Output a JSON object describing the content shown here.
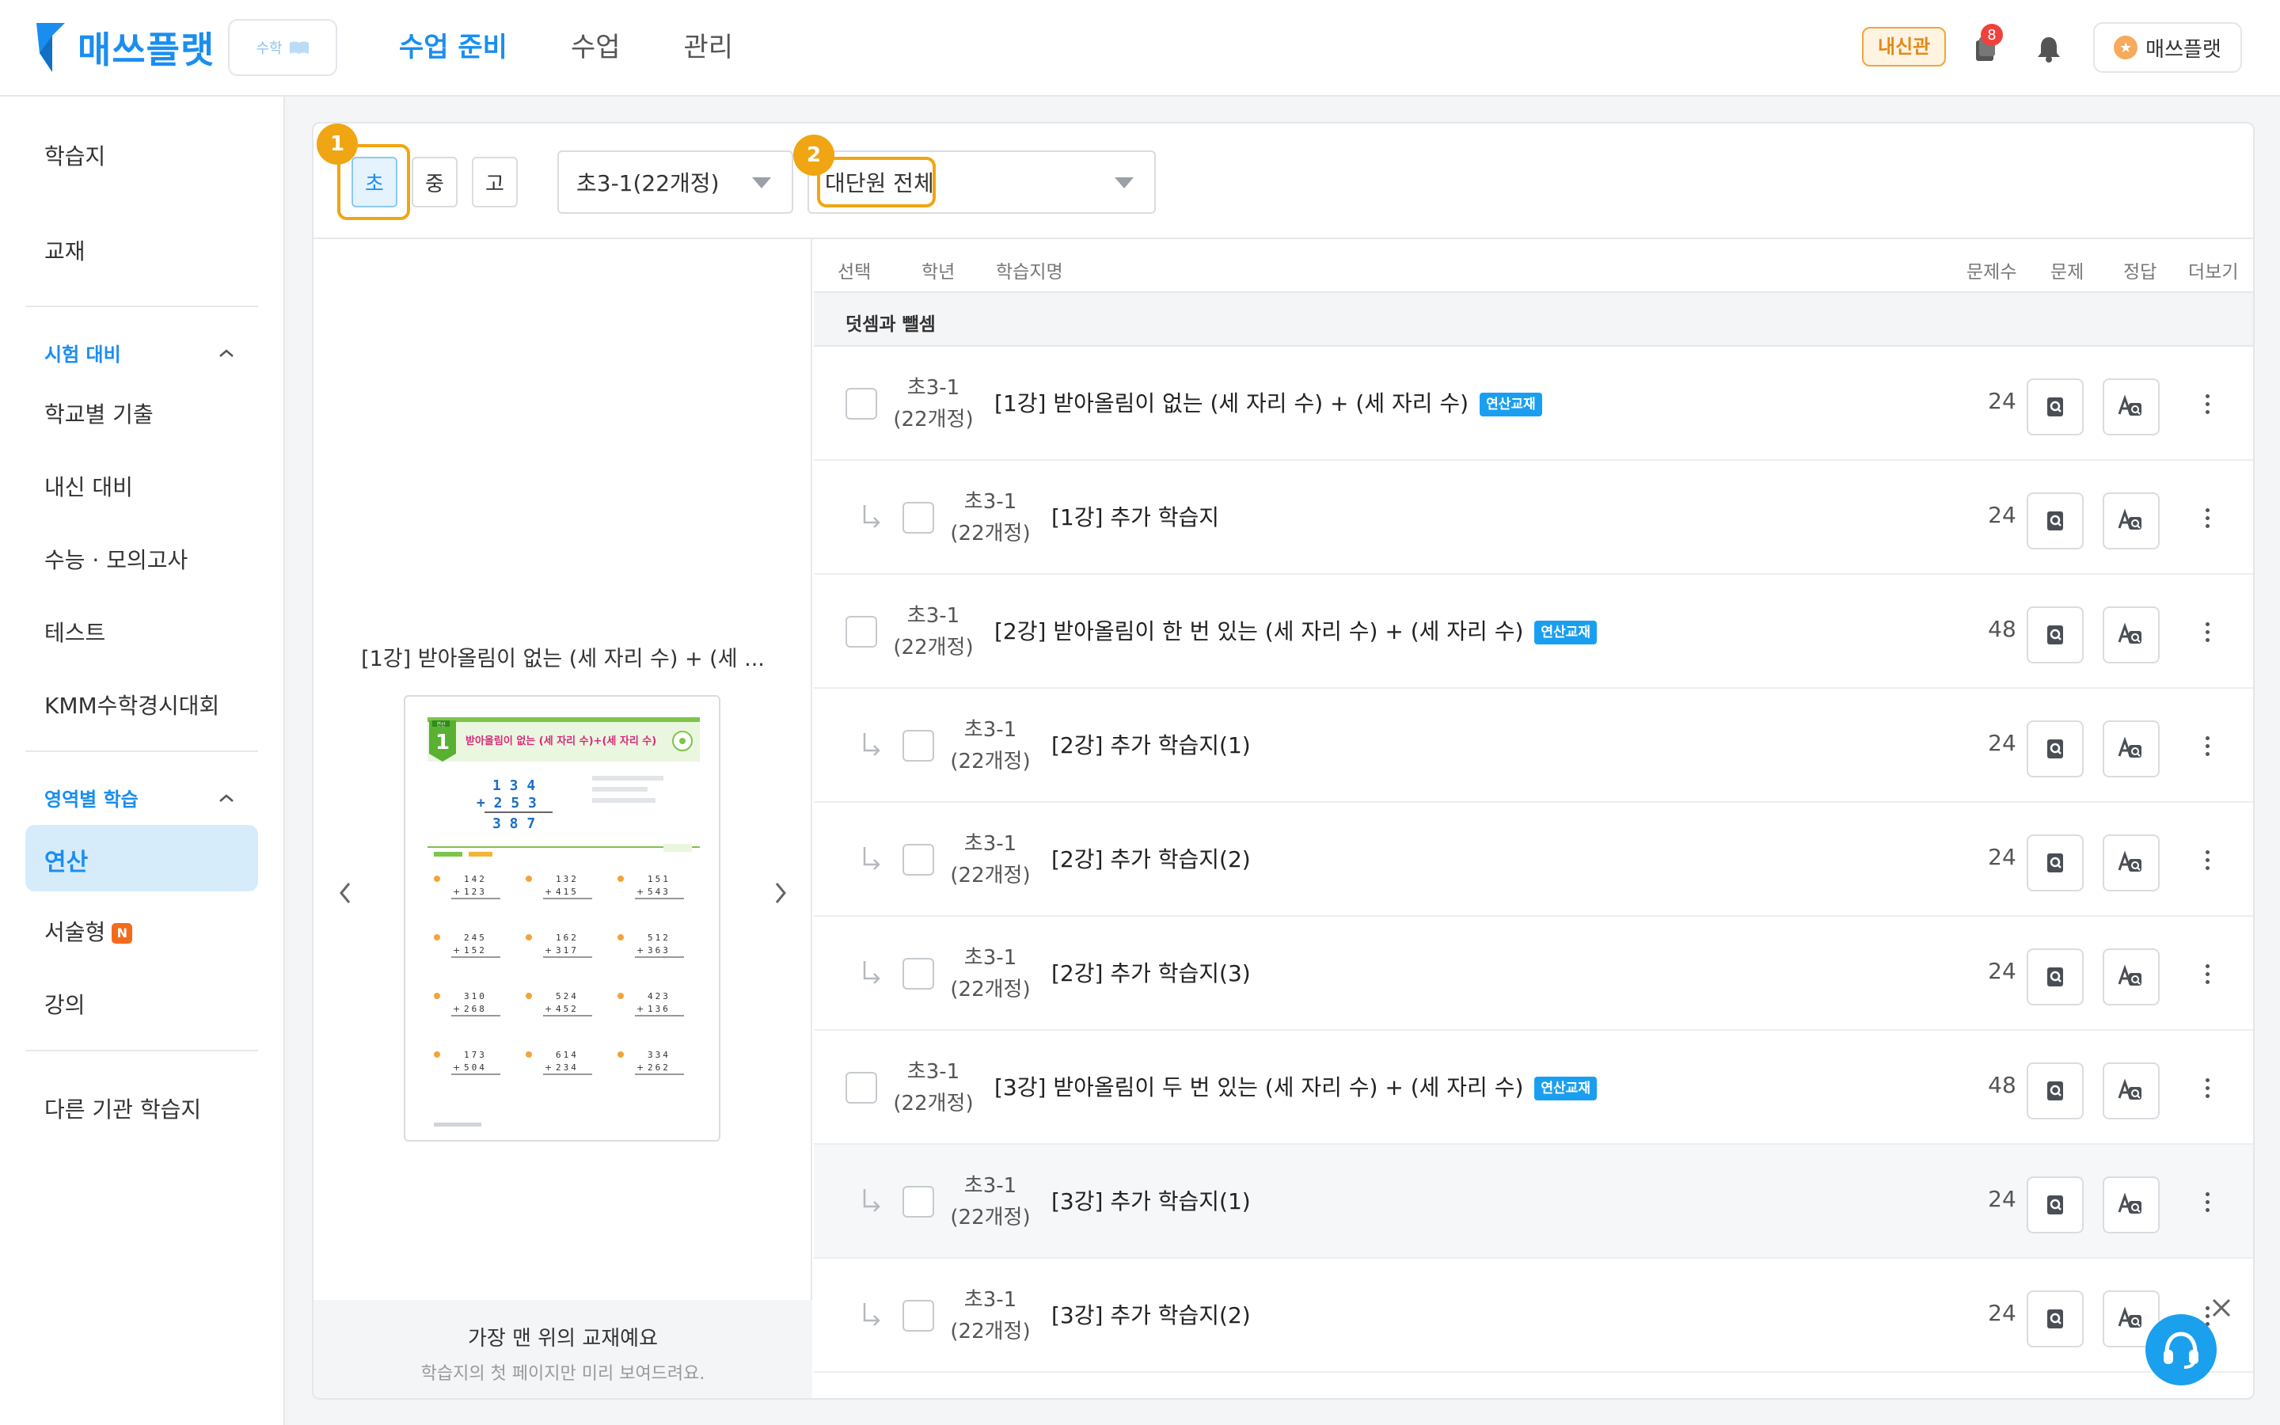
{
  "header": {
    "brand": "매쓰플랫",
    "subject": "수학",
    "nav": [
      "수업 준비",
      "수업",
      "관리"
    ],
    "naesin_label": "내신관",
    "notification_count": "8",
    "user_name": "매쓰플랫",
    "colors": {
      "brand": "#1a8ef0",
      "accent": "#f0a512"
    }
  },
  "sidebar": {
    "items_top": [
      "학습지",
      "교재"
    ],
    "section_exam": "시험 대비",
    "items_exam": [
      "학교별 기출",
      "내신 대비",
      "수능 · 모의고사",
      "테스트",
      "KMM수학경시대회"
    ],
    "section_area": "영역별 학습",
    "items_area": [
      "연산",
      "서술형",
      "강의"
    ],
    "new_badge": "N",
    "item_other": "다른 기관 학습지"
  },
  "filters": {
    "levels": [
      "초",
      "중",
      "고"
    ],
    "selected_level": "초",
    "grade_select": "초3-1(22개정)",
    "unit_select": "대단원 전체",
    "callout_1": "1",
    "callout_2": "2"
  },
  "preview": {
    "title": "[1강] 받아올림이 없는 (세 자리 수) + (세 ...",
    "footer_main": "가장 맨 위의 교재예요",
    "footer_sub": "학습지의 첫 페이지만 미리 보여드려요."
  },
  "table": {
    "headers": {
      "select": "선택",
      "grade": "학년",
      "name": "학습지명",
      "count": "문제수",
      "problem": "문제",
      "answer": "정답",
      "more": "더보기"
    },
    "group": "덧셈과 뺄셈",
    "grade_line1": "초3-1",
    "grade_line2": "(22개정)",
    "tag": "연산교재",
    "rows": [
      {
        "name": "[1강] 받아올림이 없는 (세 자리 수) + (세 자리 수)",
        "count": "24"
      },
      {
        "name": "[1강] 추가 학습지",
        "count": "24"
      },
      {
        "name": "[2강] 받아올림이 한 번 있는 (세 자리 수) + (세 자리 수)",
        "count": "48"
      },
      {
        "name": "[2강] 추가 학습지(1)",
        "count": "24"
      },
      {
        "name": "[2강] 추가 학습지(2)",
        "count": "24"
      },
      {
        "name": "[2강] 추가 학습지(3)",
        "count": "24"
      },
      {
        "name": "[3강] 받아올림이 두 번 있는 (세 자리 수) + (세 자리 수)",
        "count": "48"
      },
      {
        "name": "[3강] 추가 학습지(1)",
        "count": "24"
      },
      {
        "name": "[3강] 추가 학습지(2)",
        "count": "24"
      }
    ]
  },
  "worksheet_thumb": {
    "header_tag": "연산",
    "lesson_number": "1",
    "heading": "받아올림이 없는 (세 자리 수)+(세 자리 수)",
    "example_top": "1 3 4",
    "example_mid": "+ 2 5 3",
    "example_sum": "3 8 7",
    "problems": [
      [
        "142",
        "123"
      ],
      [
        "132",
        "415"
      ],
      [
        "151",
        "543"
      ],
      [
        "245",
        "152"
      ],
      [
        "162",
        "317"
      ],
      [
        "512",
        "363"
      ],
      [
        "310",
        "268"
      ],
      [
        "524",
        "452"
      ],
      [
        "423",
        "136"
      ],
      [
        "173",
        "504"
      ],
      [
        "614",
        "234"
      ],
      [
        "334",
        "262"
      ]
    ]
  }
}
